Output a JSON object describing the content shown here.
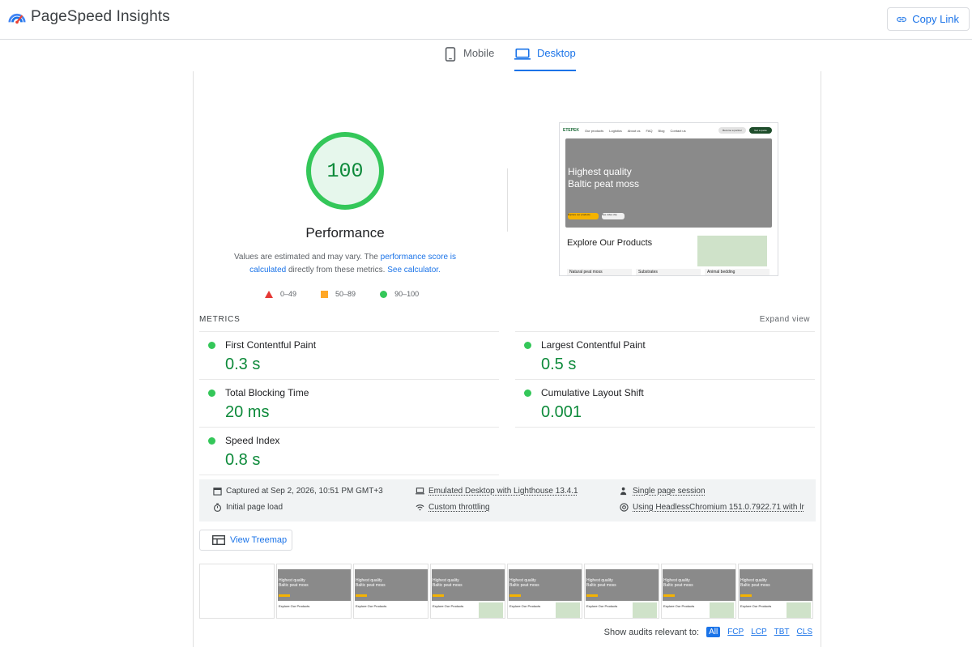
{
  "header": {
    "app_title": "PageSpeed Insights",
    "copy_link_label": "Copy Link"
  },
  "tabs": [
    {
      "label": "Mobile",
      "icon": "smartphone-icon",
      "selected": false
    },
    {
      "label": "Desktop",
      "icon": "laptop-icon",
      "selected": true
    }
  ],
  "performance": {
    "score": "100",
    "title": "Performance",
    "note_prefix": "Values are estimated and may vary. The ",
    "note_link1": "performance score is calculated",
    "note_middle": " directly from these metrics. ",
    "note_link2": "See calculator.",
    "legend": [
      {
        "range": "0–49",
        "color": "#e53935"
      },
      {
        "range": "50–89",
        "color": "#ffa726"
      },
      {
        "range": "90–100",
        "color": "#34c759"
      }
    ]
  },
  "screenshot": {
    "logo": "ETEPEK",
    "nav": [
      "Our products",
      "Logistics",
      "About us",
      "FAQ",
      "Blog",
      "Contact us"
    ],
    "pill1": "Become a partner",
    "pill2": "Get a quote",
    "hero_title_line1": "Highest quality",
    "hero_title_line2": "Baltic peat moss",
    "hero_button1": "Explore our products",
    "hero_button2": "See video clip",
    "explore_title": "Explore Our Products",
    "categories": [
      "Natural peat moss",
      "Substrates",
      "Animal bedding"
    ]
  },
  "metrics": {
    "heading": "METRICS",
    "expand_label": "Expand view",
    "items": [
      {
        "label": "First Contentful Paint",
        "value": "0.3 s"
      },
      {
        "label": "Largest Contentful Paint",
        "value": "0.5 s"
      },
      {
        "label": "Total Blocking Time",
        "value": "20 ms"
      },
      {
        "label": "Cumulative Layout Shift",
        "value": "0.001"
      },
      {
        "label": "Speed Index",
        "value": "0.8 s"
      }
    ]
  },
  "runtime": {
    "captured": "Captured at Sep 2, 2026, 10:51 PM GMT+3",
    "load": "Initial page load",
    "device": "Emulated Desktop with Lighthouse 13.4.1",
    "throttling": "Custom throttling",
    "session": "Single page session",
    "browser": "Using HeadlessChromium 151.0.7922.71 with lr"
  },
  "treemap_label": "View Treemap",
  "filmstrip": {
    "frame_title_line1": "Highest quality",
    "frame_title_line2": "Baltic peat moss",
    "frame_explore": "Explore Our Products"
  },
  "audits_filter": {
    "label": "Show audits relevant to:",
    "chips": [
      "All",
      "FCP",
      "LCP",
      "TBT",
      "CLS"
    ]
  },
  "colors": {
    "accent": "#1a73e8",
    "pass": "#0d8a3a",
    "pass_dot": "#34c759"
  }
}
